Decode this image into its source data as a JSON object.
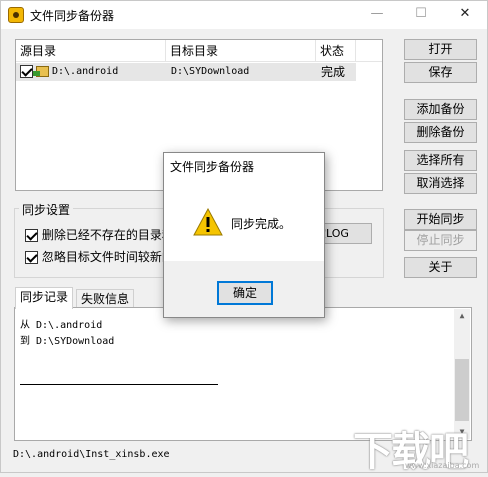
{
  "window": {
    "title": "文件同步备份器",
    "min": "—",
    "max": "☐",
    "close": "✕"
  },
  "list": {
    "headers": [
      "源目录",
      "目标目录",
      "状态"
    ],
    "rows": [
      {
        "source": "D:\\.android",
        "target": "D:\\SYDownload",
        "status": "完成",
        "checked": true
      }
    ]
  },
  "buttons": {
    "open": "打开",
    "save": "保存",
    "add_backup": "添加备份",
    "delete_backup": "删除备份",
    "select_all": "选择所有",
    "deselect": "取消选择",
    "start_sync": "开始同步",
    "stop_sync": "停止同步",
    "about": "关于"
  },
  "sync_settings": {
    "label": "同步设置",
    "option1": "删除已经不存在的目录和",
    "option2": "忽略目标文件时间较新的",
    "clear_log": "空LOG"
  },
  "tabs": [
    "同步记录",
    "失败信息"
  ],
  "log": {
    "line1": "从 D:\\.android",
    "line2": "到 D:\\SYDownload"
  },
  "status_text": "D:\\.android\\Inst_xinsb.exe",
  "dialog": {
    "title": "文件同步备份器",
    "message": "同步完成。",
    "ok": "确定",
    "icon": "warning-icon"
  },
  "watermark": {
    "text": "下载吧",
    "sub": "www.xiazaiba.com"
  }
}
